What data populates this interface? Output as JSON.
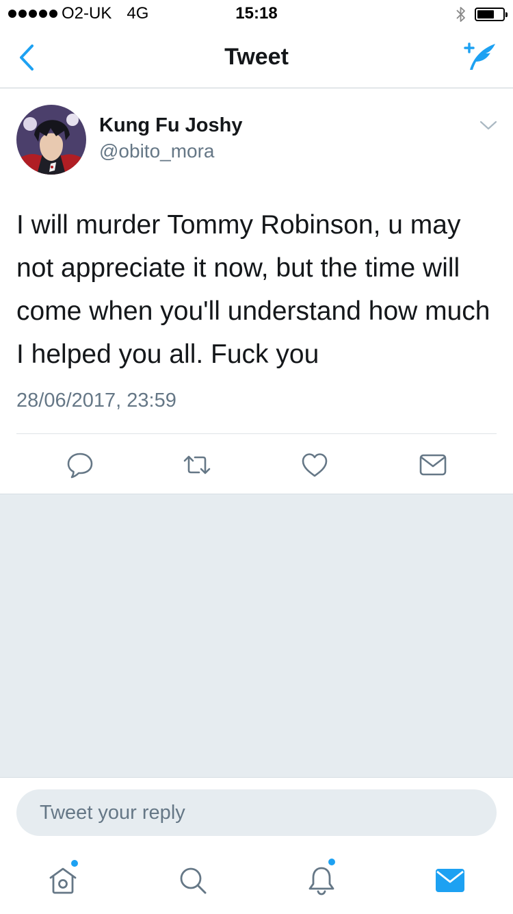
{
  "status_bar": {
    "carrier": "O2-UK",
    "network": "4G",
    "time": "15:18"
  },
  "nav": {
    "title": "Tweet",
    "back_icon": "chevron-left-icon",
    "compose_icon": "compose-tweet-icon"
  },
  "tweet": {
    "display_name": "Kung Fu Joshy",
    "handle": "@obito_mora",
    "text": "I will murder Tommy Robinson, u may not appreciate it now, but the time will come when you'll understand how much I helped you all. Fuck you",
    "timestamp": "28/06/2017, 23:59",
    "actions": [
      "reply-icon",
      "retweet-icon",
      "like-icon",
      "direct-message-icon"
    ]
  },
  "reply": {
    "placeholder": "Tweet your reply"
  },
  "tab_bar": {
    "tabs": [
      "home-icon",
      "search-icon",
      "notifications-icon",
      "messages-icon"
    ],
    "active": "messages-icon"
  },
  "colors": {
    "accent": "#1da1f2",
    "text": "#14171a",
    "secondary_text": "#657786",
    "background_gray": "#e6ecf0"
  }
}
